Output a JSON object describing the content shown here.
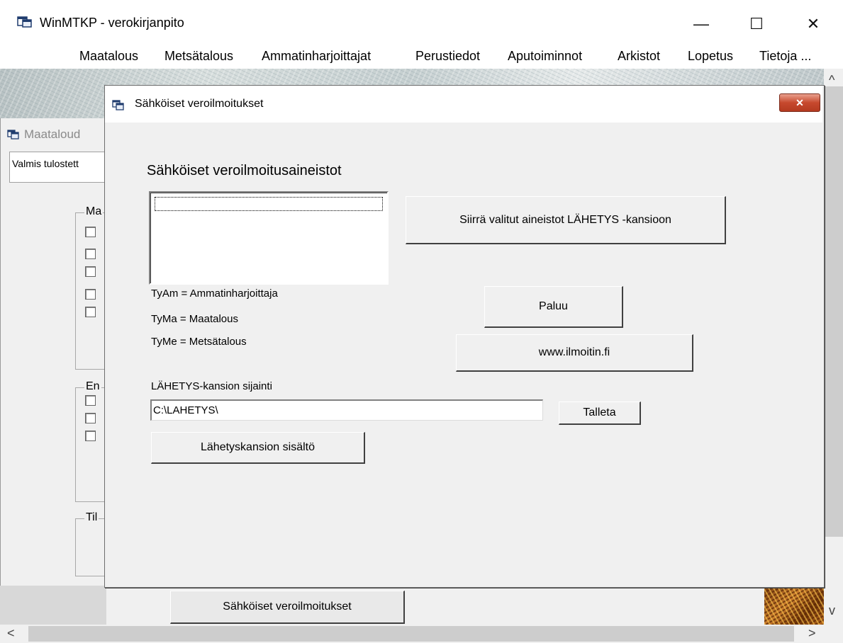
{
  "app": {
    "title": "WinMTKP - verokirjanpito",
    "menu": [
      "Maatalous",
      "Metsätalous",
      "Ammatinharjoittajat",
      "Perustiedot",
      "Aputoiminnot",
      "Arkistot",
      "Lopetus",
      "Tietoja ..."
    ]
  },
  "background_window": {
    "title": "Maataloud",
    "field_value": "Valmis tulostett",
    "group1_label": "Ma",
    "group2_label": "En",
    "group3_label": "Til",
    "bottom_button": "Sähköiset veroilmoitukset"
  },
  "dialog": {
    "title": "Sähköiset veroilmoitukset",
    "close_label": "✕",
    "heading": "Sähköiset veroilmoitusaineistot",
    "move_button": "Siirrä valitut aineistot LÄHETYS -kansioon",
    "legend": [
      "TyAm = Ammatinharjoittaja",
      "TyMa = Maatalous",
      "TyMe = Metsätalous"
    ],
    "back_button": "Paluu",
    "link_button": "www.ilmoitin.fi",
    "folder_label": "LÄHETYS-kansion sijainti",
    "folder_path": "C:\\LAHETYS\\",
    "save_button": "Talleta",
    "contents_button": "Lähetyskansion sisältö"
  },
  "window_controls": {
    "minimize": "—",
    "maximize": "☐",
    "close": "✕"
  },
  "scrollbars": {
    "up": "^",
    "down": "v",
    "left": "<",
    "right": ">"
  }
}
